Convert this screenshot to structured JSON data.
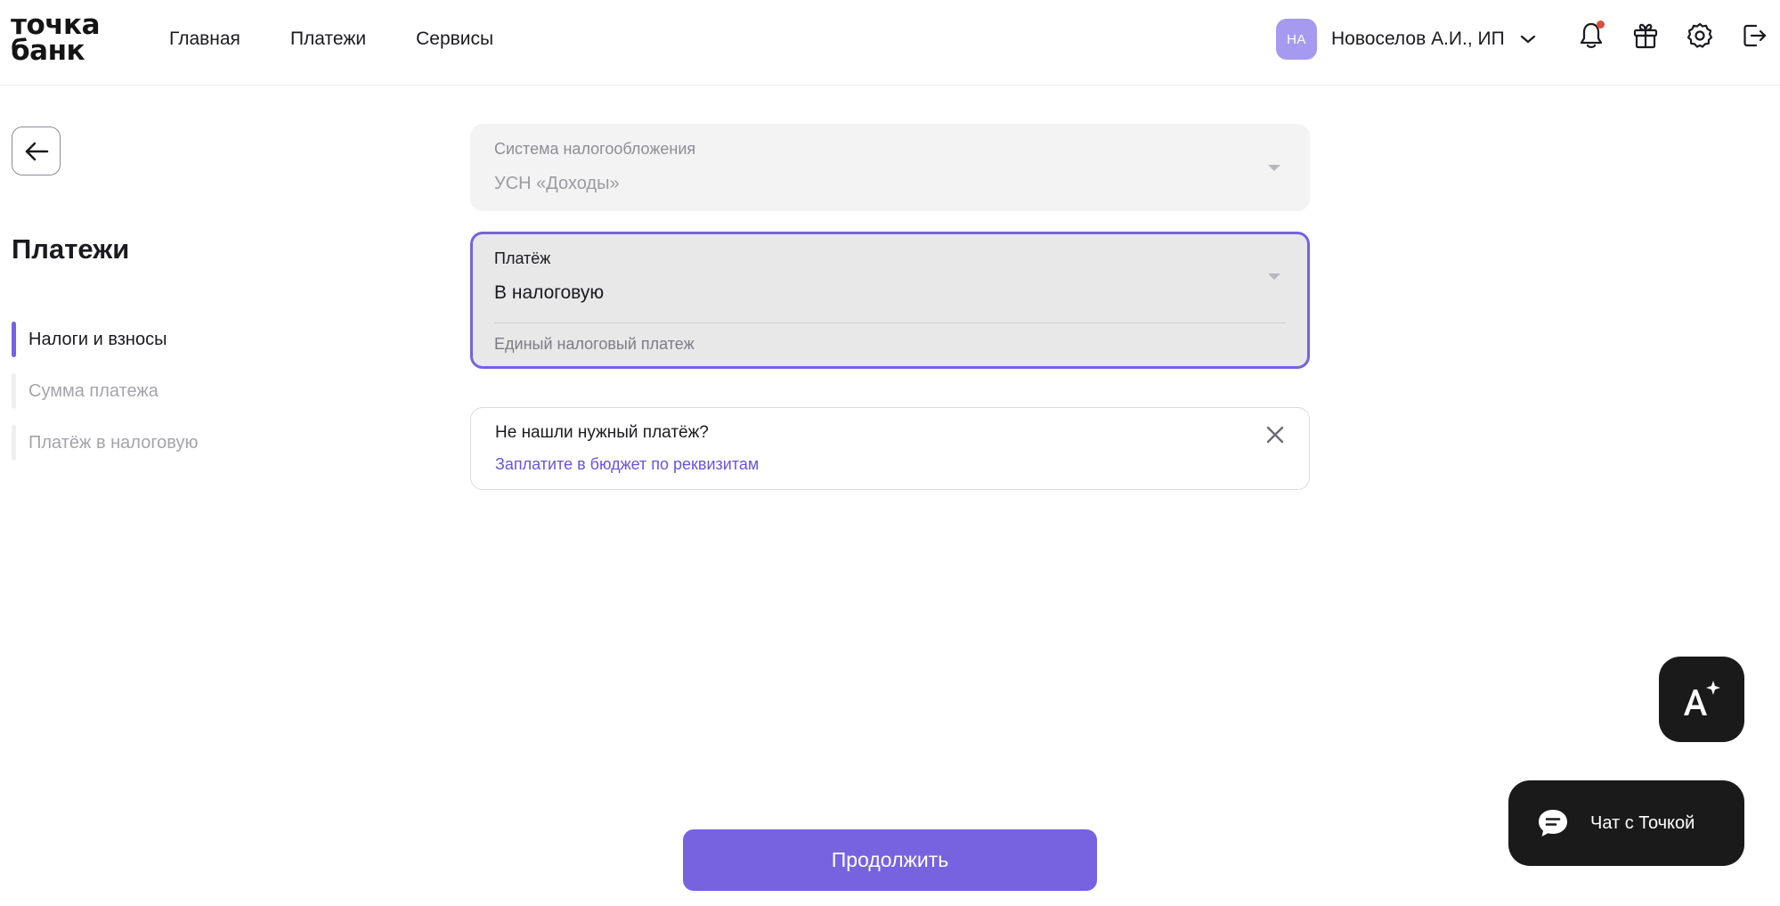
{
  "header": {
    "logo_line1": "точка",
    "logo_line2": "банк",
    "nav": [
      "Главная",
      "Платежи",
      "Сервисы"
    ],
    "account": {
      "initials": "НА",
      "name": "Новоселов А.И., ИП"
    },
    "icons": [
      "bell-icon",
      "gift-icon",
      "gear-icon",
      "logout-icon"
    ],
    "notification_dot_color": "#d8503f"
  },
  "sidebar": {
    "title": "Платежи",
    "steps": [
      {
        "label": "Налоги и взносы",
        "active": true
      },
      {
        "label": "Сумма платежа",
        "active": false
      },
      {
        "label": "Платёж в налоговую",
        "active": false
      }
    ]
  },
  "form": {
    "tax_system": {
      "label": "Система налогообложения",
      "value": "УСН «Доходы»"
    },
    "payment": {
      "label": "Платёж",
      "value": "В налоговую",
      "hint": "Единый налоговый платеж"
    },
    "notice": {
      "title": "Не нашли нужный платёж?",
      "link": "Заплатите в бюджет по реквизитам"
    },
    "continue_label": "Продолжить"
  },
  "floating": {
    "chat_label": "Чат с Точкой"
  },
  "colors": {
    "accent": "#7662e0",
    "link": "#6a55d8",
    "dark": "#1a1a1a",
    "avatar": "#a59af0"
  }
}
